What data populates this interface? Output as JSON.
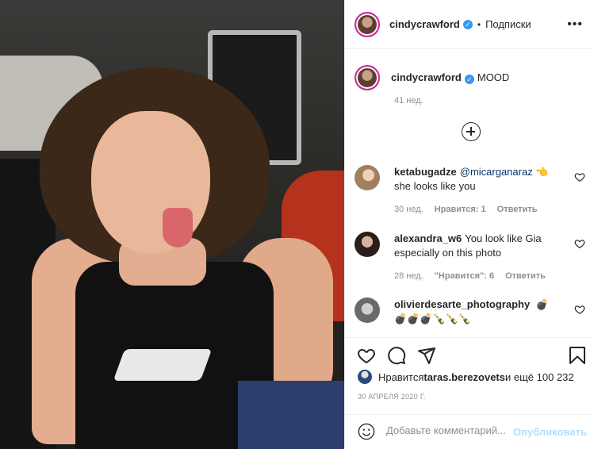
{
  "post": {
    "author": "cindycrawford",
    "follow_label": "Подписки",
    "more_glyph": "•••",
    "verified_glyph": "✓"
  },
  "caption": {
    "user": "cindycrawford",
    "text": "MOOD",
    "time": "41 нед."
  },
  "comments": [
    {
      "user": "ketabugadze",
      "mention": "@micarganaraz",
      "text_inline": " 👈",
      "text_line2": "she looks like you",
      "time": "30 нед.",
      "likes": "Нравится: 1",
      "reply": "Ответить"
    },
    {
      "user": "alexandra_w6",
      "text": "You look like Gia especially on this photo",
      "time": "28 нед.",
      "likes": "\"Нравится\": 6",
      "reply": "Ответить"
    },
    {
      "user": "olivierdesarte_photography",
      "text_inline": " 💣",
      "text_line2": "💣💣💣🍾🍾🍾"
    }
  ],
  "likes": {
    "prefix": "Нравится ",
    "user": "taras.berezovets",
    "suffix": " и ещё 100 232"
  },
  "date": "30 АПРЕЛЯ 2020 Г.",
  "add_comment": {
    "placeholder": "Добавьте комментарий...",
    "publish_label": "Опубликовать"
  },
  "colors": {
    "accent": "#3897f0",
    "publish_disabled": "#b2dffc",
    "muted": "#8e8e8e",
    "text": "#262626"
  }
}
